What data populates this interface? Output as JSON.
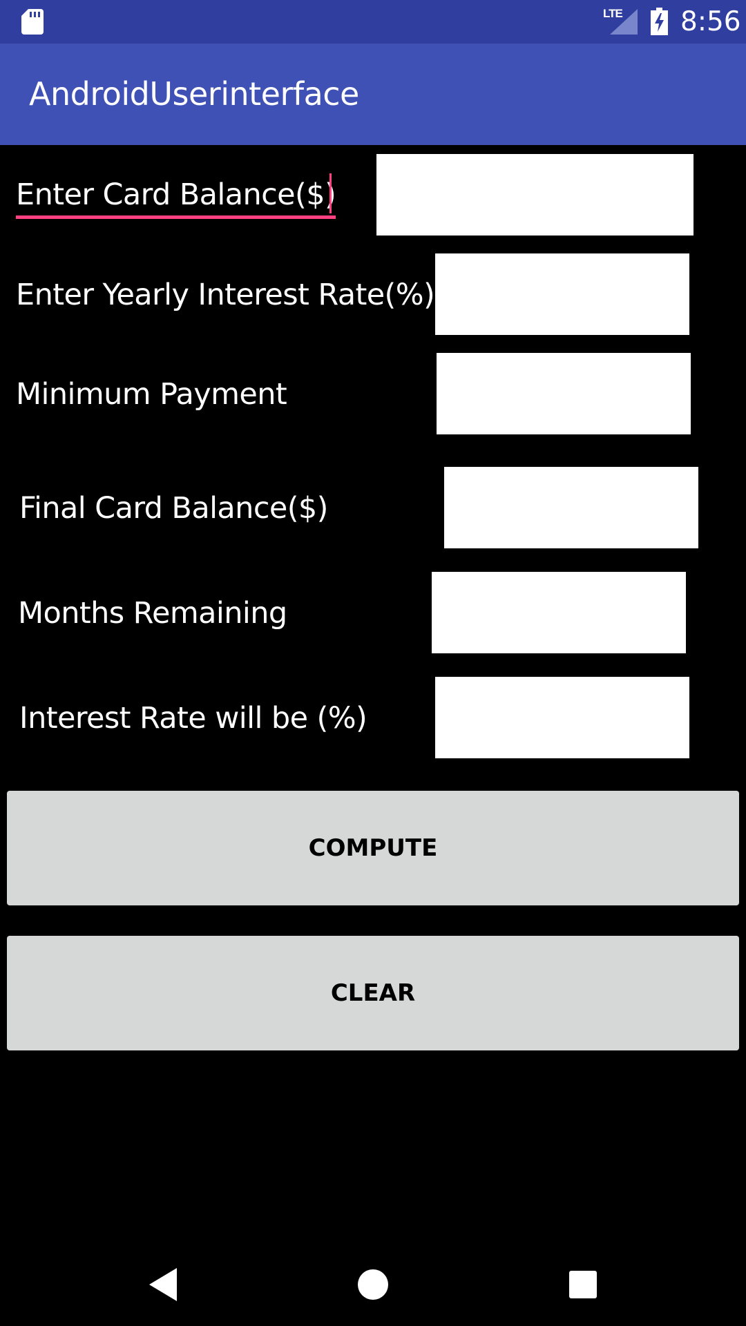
{
  "status_bar": {
    "time": "8:56",
    "network": "LTE",
    "icons": [
      "sd-card-icon",
      "signal-icon",
      "battery-charging-icon"
    ]
  },
  "app_bar": {
    "title": "AndroidUserinterface"
  },
  "form": {
    "card_balance_label": "Enter Card Balance($)",
    "yearly_interest_label": "Enter Yearly Interest Rate(%)",
    "minimum_payment_label": "Minimum Payment",
    "final_balance_label": "Final Card Balance($)",
    "months_remaining_label": "Months Remaining",
    "interest_will_be_label": "Interest Rate will be (%)",
    "card_balance_value": "",
    "yearly_interest_value": "",
    "minimum_payment_value": "",
    "final_balance_value": "",
    "months_remaining_value": "",
    "interest_will_be_value": ""
  },
  "buttons": {
    "compute": "COMPUTE",
    "clear": "CLEAR"
  },
  "colors": {
    "status_bar": "#303F9F",
    "app_bar": "#3F51B5",
    "accent": "#FF4081",
    "button": "#D6D7D7",
    "background": "#000000"
  },
  "nav_bar": {
    "icons": [
      "back-icon",
      "home-icon",
      "recents-icon"
    ]
  }
}
